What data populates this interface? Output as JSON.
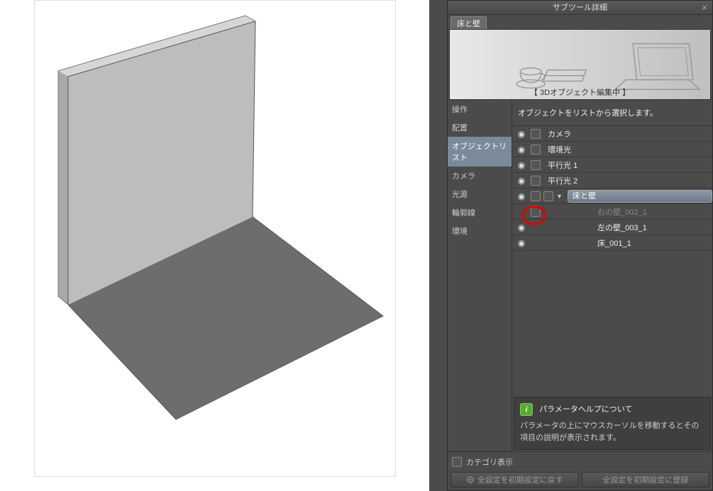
{
  "panel": {
    "title": "サブツール詳細",
    "tag": "床と壁",
    "editing_label": "【 3Dオブジェクト編集中 】"
  },
  "sidebar": {
    "items": [
      {
        "label": "操作"
      },
      {
        "label": "配置"
      },
      {
        "label": "オブジェクトリスト"
      },
      {
        "label": "カメラ"
      },
      {
        "label": "光源"
      },
      {
        "label": "輪郭線"
      },
      {
        "label": "環境"
      }
    ],
    "selected_index": 2
  },
  "hint": "オブジェクトをリストから選択します。",
  "objects": [
    {
      "label": "カメラ",
      "visible": true,
      "indent": 0
    },
    {
      "label": "環境光",
      "visible": true,
      "indent": 0
    },
    {
      "label": "平行光 1",
      "visible": true,
      "indent": 0
    },
    {
      "label": "平行光 2",
      "visible": true,
      "indent": 0
    },
    {
      "label": "床と壁",
      "visible": true,
      "indent": 0,
      "group": true
    },
    {
      "label": "右の壁_002_1",
      "visible": false,
      "indent": 1,
      "dim": true,
      "highlight": true
    },
    {
      "label": "左の壁_003_1",
      "visible": true,
      "indent": 1
    },
    {
      "label": "床_001_1",
      "visible": true,
      "indent": 1
    }
  ],
  "help": {
    "title": "パラメータヘルプについて",
    "body": "パラメータの上にマウスカーソルを移動するとその項目の説明が表示されます。"
  },
  "bottom": {
    "category_label": "カテゴリ表示",
    "reset_btn": "全設定を初期設定に戻す",
    "save_btn": "全設定を初期設定に登録"
  }
}
